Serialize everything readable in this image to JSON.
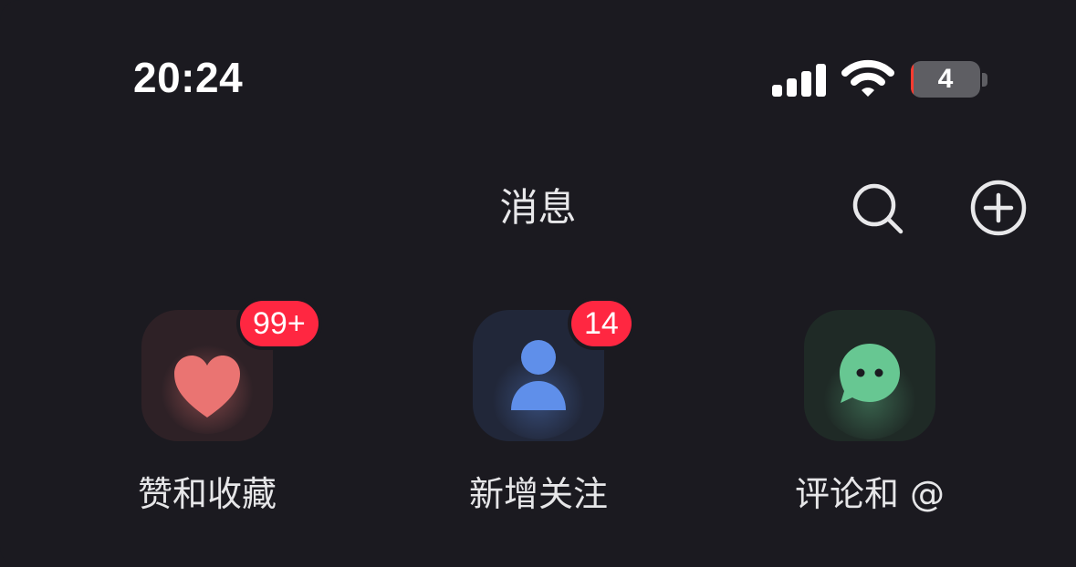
{
  "status_bar": {
    "time": "20:24",
    "battery_level": "4",
    "battery_fraction": 0.04,
    "signal_bars": 4
  },
  "header": {
    "title": "消息",
    "icons": {
      "search": "search-icon",
      "add": "add-circle-icon"
    }
  },
  "categories": [
    {
      "label": "赞和收藏",
      "badge": "99+",
      "icon": "heart-icon",
      "color": "#ea7472",
      "tile_color": "#2e2126"
    },
    {
      "label": "新增关注",
      "badge": "14",
      "icon": "person-icon",
      "color": "#5f8fea",
      "tile_color": "#212739"
    },
    {
      "label": "评论和 @",
      "badge": "",
      "icon": "chat-bubble-icon",
      "color": "#67c792",
      "tile_color": "#1f2a26"
    }
  ],
  "colors": {
    "background": "#1b1a20",
    "badge": "#ff2741",
    "text": "#e8e8ea"
  }
}
